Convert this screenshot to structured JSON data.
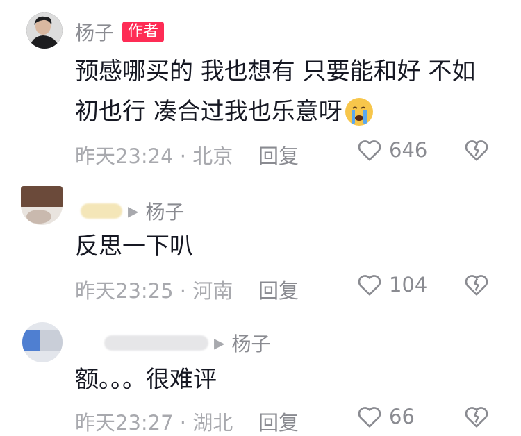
{
  "comments": [
    {
      "author": "杨子",
      "badge": "作者",
      "text_lines": [
        "预感哪买的 我也想有 只要能和好 不如",
        "初也行 凑合过我也乐意呀"
      ],
      "emoji": "😭",
      "time_location": "昨天23:24 · 北京",
      "reply_label": "回复",
      "likes": "646"
    },
    {
      "reply_target": "杨子",
      "text": "反思一下叭",
      "time_location": "昨天23:25 · 河南",
      "reply_label": "回复",
      "likes": "104"
    },
    {
      "reply_target": "杨子",
      "text": "额。。。很难评",
      "time_location": "昨天23:27 · 湖北",
      "reply_label": "回复",
      "likes": "66"
    }
  ],
  "colors": {
    "badge": "#fe2c55",
    "meta_text": "#a8a9ae",
    "action_text": "#8a8b91",
    "body_text": "#161823"
  },
  "icons": {
    "like": "heart-outline-icon",
    "dislike": "broken-heart-icon",
    "reply_arrow": "play-triangle-icon"
  }
}
